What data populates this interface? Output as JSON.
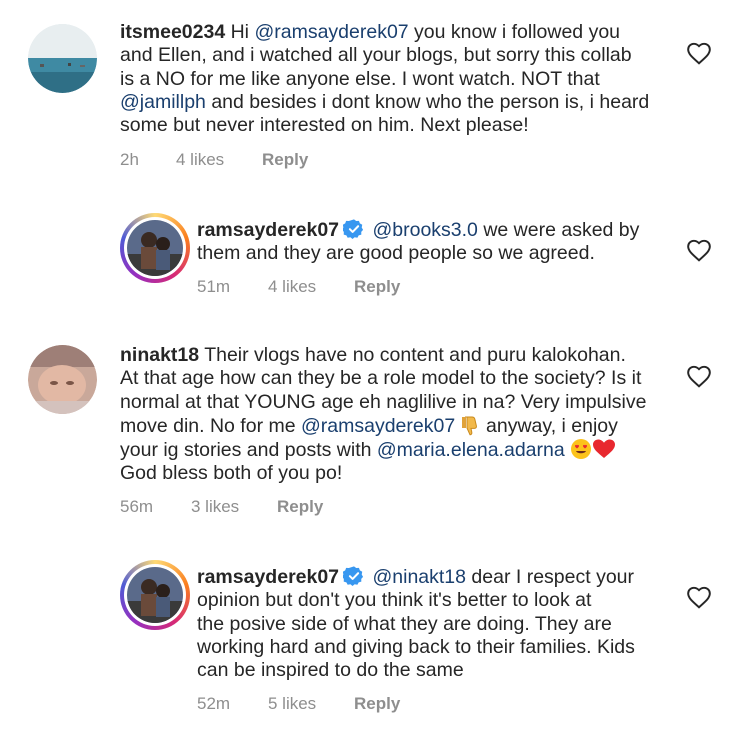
{
  "comments": [
    {
      "username": "itsmee0234",
      "lines": [
        [
          "Hi ",
          "@ramsayderek07",
          " you know i followed you"
        ],
        [
          "and Ellen, and i watched all your blogs,  but sorry this collab"
        ],
        [
          "is a NO for me like anyone else. I wont watch. NOT that"
        ],
        [
          "@jamillph",
          " and besides i dont know who the person is, i heard"
        ],
        [
          "some but never interested on him. Next please!"
        ]
      ],
      "time": "2h",
      "likes": "4 likes",
      "reply": "Reply"
    },
    {
      "username": "ramsayderek07",
      "lines": [
        [
          "@brooks3.0",
          " we were asked by"
        ],
        [
          "them and they are good people so we agreed."
        ]
      ],
      "time": "51m",
      "likes": "4 likes",
      "reply": "Reply"
    },
    {
      "username": "ninakt18",
      "lines": [
        [
          "Their vlogs have no content and puru kalokohan."
        ],
        [
          "At that age how can they be a role model to the society? Is it"
        ],
        [
          "normal at that YOUNG age eh naglilive in na? Very impulsive"
        ],
        [
          "move din. No for me ",
          "@ramsayderek07",
          " anyway, i enjoy"
        ],
        [
          "your ig stories and posts with ",
          "@maria.elena.adarna",
          " "
        ],
        [
          "God bless both of you po!"
        ]
      ],
      "time": "56m",
      "likes": "3 likes",
      "reply": "Reply"
    },
    {
      "username": "ramsayderek07",
      "lines": [
        [
          "@ninakt18",
          " dear I respect your"
        ],
        [
          "opinion but don't you think it's better to look at"
        ],
        [
          "the posive side of what they are doing. They are"
        ],
        [
          "working hard and giving back to their families. Kids"
        ],
        [
          "can be inspired to do the same"
        ]
      ],
      "time": "52m",
      "likes": "5 likes",
      "reply": "Reply"
    }
  ],
  "colors": {
    "text": "#262626",
    "mention": "#1a3f6e",
    "meta": "#8e8e8e",
    "verified": "#3897f0"
  },
  "icons": [
    "heart-icon",
    "verified-badge-icon",
    "thumbs-down-emoji",
    "heart-eyes-emoji",
    "red-heart-emoji"
  ]
}
